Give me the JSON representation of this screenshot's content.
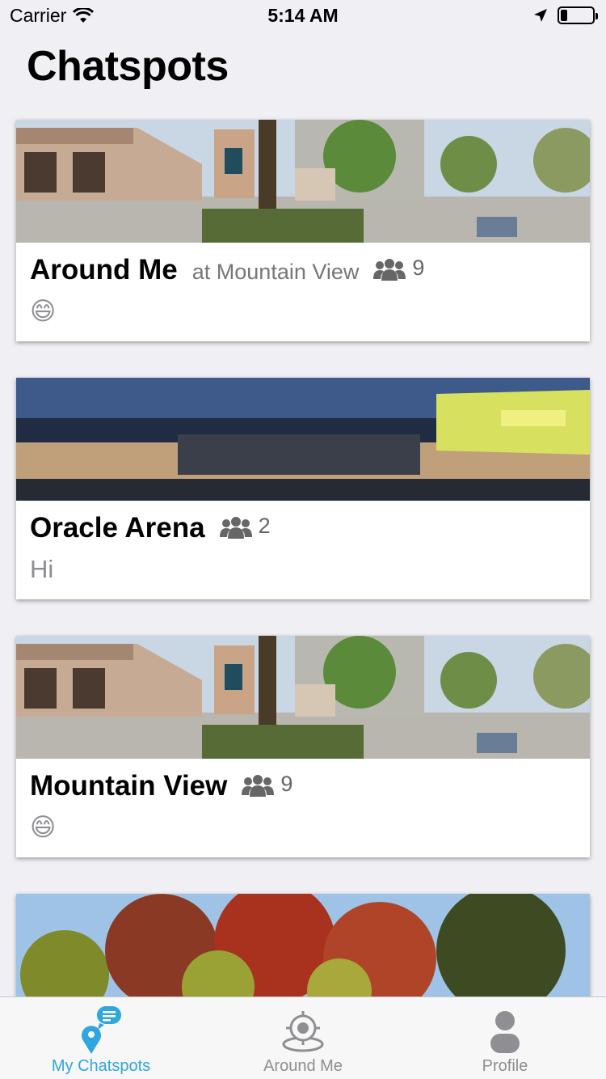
{
  "status": {
    "carrier": "Carrier",
    "time": "5:14 AM"
  },
  "page": {
    "title": "Chatspots"
  },
  "cards": [
    {
      "title": "Around Me",
      "subtitle": "at Mountain View",
      "members": "9",
      "message": "😄"
    },
    {
      "title": "Oracle Arena",
      "members": "2",
      "message": "Hi"
    },
    {
      "title": "Mountain View",
      "members": "9",
      "message": "😄"
    }
  ],
  "tabs": [
    {
      "label": "My Chatspots",
      "icon": "chat-pin-icon",
      "active": true
    },
    {
      "label": "Around Me",
      "icon": "location-target-icon",
      "active": false
    },
    {
      "label": "Profile",
      "icon": "person-icon",
      "active": false
    }
  ],
  "colors": {
    "accent": "#2ea7e0",
    "background": "#efeff4",
    "inactive": "#8e8e93"
  }
}
